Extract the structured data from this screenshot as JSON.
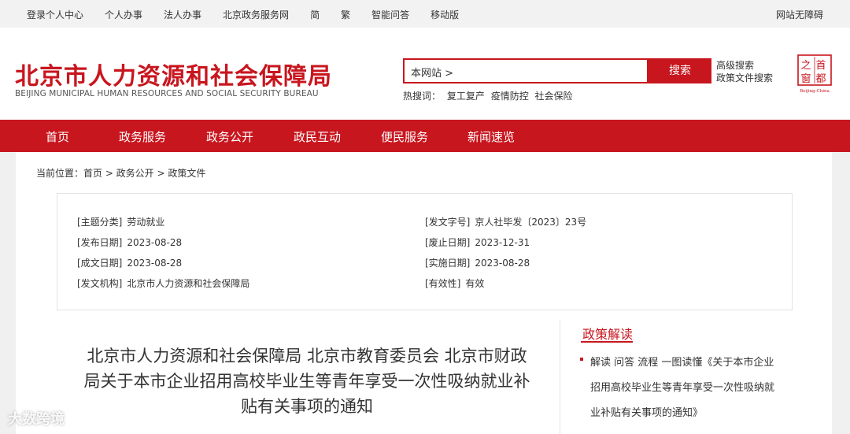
{
  "topbar": {
    "links": [
      "登录个人中心",
      "个人办事",
      "法人办事",
      "北京政务服务网",
      "简",
      "繁",
      "智能问答",
      "移动版"
    ],
    "right": "网站无障碍"
  },
  "header": {
    "logo_cn": "北京市人力资源和社会保障局",
    "logo_en": "BEIJING MUNICIPAL HUMAN RESOURCES AND SOCIAL SECURITY BUREAU",
    "search_value": "本网站 >",
    "search_button": "搜索",
    "advanced_search": "高级搜索",
    "policy_search": "政策文件搜索",
    "hot_label": "热搜词：",
    "hot_words": [
      "复工复产",
      "疫情防控",
      "社会保险"
    ],
    "seal_chars": [
      "首",
      "都",
      "之",
      "窗"
    ],
    "seal_sub": "Beijing-China"
  },
  "nav": [
    "首页",
    "政务服务",
    "政务公开",
    "政民互动",
    "便民服务",
    "新闻速览"
  ],
  "breadcrumb": "当前位置：首页 > 政务公开 > 政策文件",
  "meta": {
    "topic_label": "[主题分类]",
    "topic": "劳动就业",
    "docno_label": "[发文字号]",
    "docno": "京人社毕发〔2023〕23号",
    "pub_label": "[发布日期]",
    "pub": "2023-08-28",
    "expire_label": "[废止日期]",
    "expire": "2023-12-31",
    "made_label": "[成文日期]",
    "made": "2023-08-28",
    "impl_label": "[实施日期]",
    "impl": "2023-08-28",
    "org_label": "[发文机构]",
    "org": "北京市人力资源和社会保障局",
    "valid_label": "[有效性]",
    "valid": "有效"
  },
  "doc_title": "北京市人力资源和社会保障局 北京市教育委员会 北京市财政局关于本市企业招用高校毕业生等青年享受一次性吸纳就业补贴有关事项的通知",
  "sidebar": {
    "heading": "政策解读",
    "item": "解读 问答 流程 一图读懂《关于本市企业招用高校毕业生等青年享受一次性吸纳就业补贴有关事项的通知》"
  },
  "watermark": "大数跨境"
}
